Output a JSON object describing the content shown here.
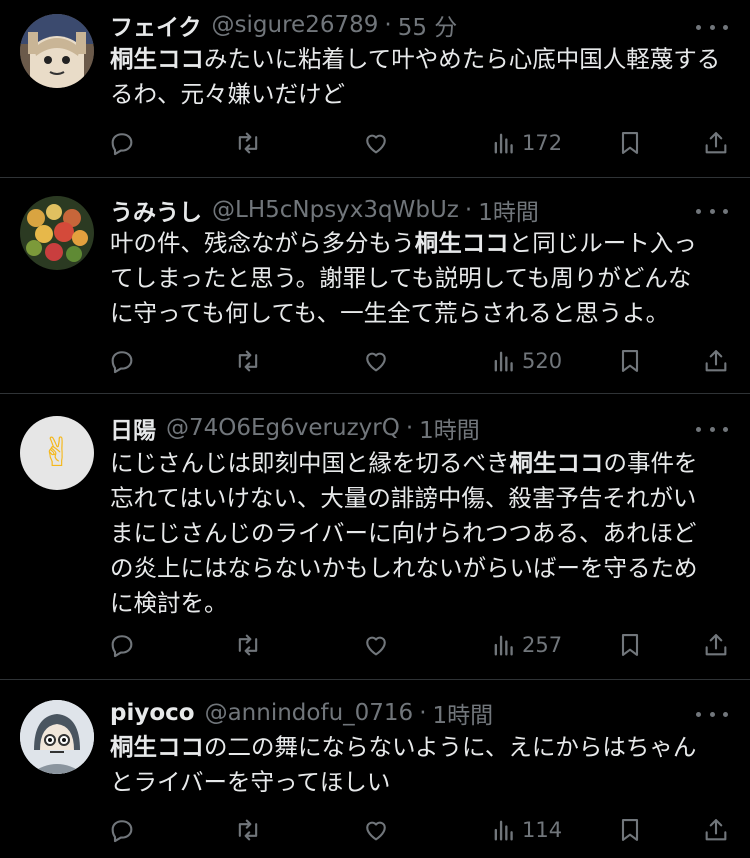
{
  "tweets": [
    {
      "name": "フェイク",
      "handle": "@sigure26789",
      "separator": "·",
      "time": "55 分",
      "body": [
        {
          "text": "桐生ココ",
          "bold": true
        },
        {
          "text": "みたいに粘着して叶やめたら心底中国人軽蔑する"
        },
        {
          "text": "るわ、元々嫌いだけど"
        }
      ],
      "views": "172",
      "avatar": "anime-character-avatar"
    },
    {
      "name": "うみうし",
      "handle": "@LH5cNpsyx3qWbUz",
      "separator": "·",
      "time": "1時間",
      "body": [
        {
          "text": "叶の件、残念ながら多分もう"
        },
        {
          "text": "桐生ココ",
          "bold": true
        },
        {
          "text": "と同じルート入っ"
        },
        {
          "text": "てしまったと思う。謝罪しても説明しても周りがどんな"
        },
        {
          "text": "に守っても何しても、一生全て荒らされると思うよ。"
        }
      ],
      "views": "520",
      "avatar": "flower-bouquet-avatar"
    },
    {
      "name": "日陽",
      "handle": "@74O6Eg6veruzyrQ",
      "separator": "·",
      "time": "1時間",
      "body": [
        {
          "text": "にじさんじは即刻中国と縁を切るべき"
        },
        {
          "text": "桐生ココ",
          "bold": true
        },
        {
          "text": "の事件を"
        },
        {
          "text": "忘れてはいけない、大量の誹謗中傷、殺害予告それがい"
        },
        {
          "text": "まにじさんじのライバーに向けられつつある、あれほど"
        },
        {
          "text": "の炎上にはならないかもしれないがらいばーを守るため"
        },
        {
          "text": "に検討を。"
        }
      ],
      "views": "257",
      "avatar": "victory-hand-avatar",
      "avatar_glyph": "✌"
    },
    {
      "name": "piyoco",
      "handle": "@annindofu_0716",
      "separator": "·",
      "time": "1時間",
      "body": [
        {
          "text": "桐生ココ",
          "bold": true
        },
        {
          "text": "の二の舞にならないように、えにからはちゃん"
        },
        {
          "text": "とライバーを守ってほしい"
        }
      ],
      "views": "114",
      "avatar": "helmet-character-avatar"
    }
  ],
  "icons": {
    "reply": "reply-icon",
    "retweet": "retweet-icon",
    "like": "heart-icon",
    "views": "analytics-icon",
    "bookmark": "bookmark-icon",
    "share": "share-icon",
    "more": "more-icon"
  },
  "colors": {
    "background": "#000000",
    "text": "#e7e9ea",
    "secondary": "#71767b",
    "divider": "#2f3336"
  }
}
